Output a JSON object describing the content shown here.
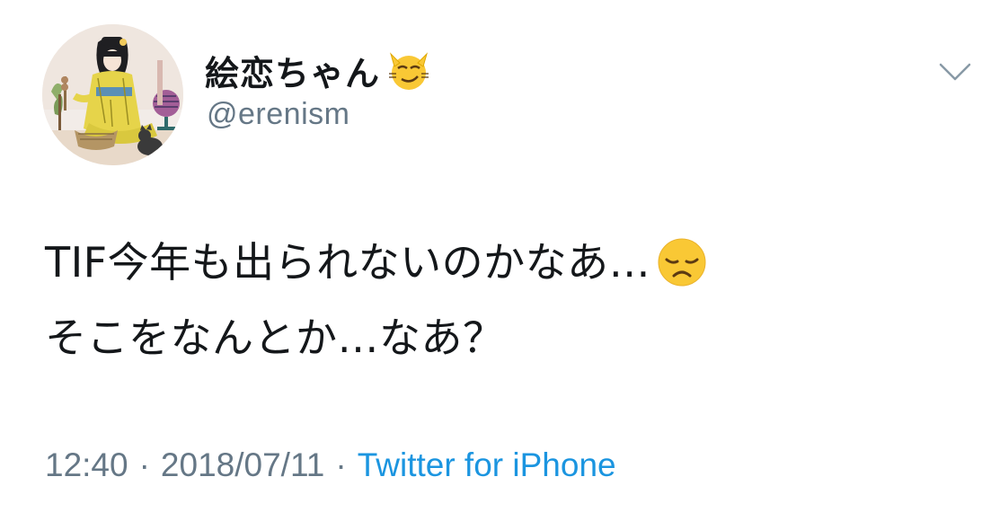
{
  "tweet": {
    "author": {
      "display_name": "絵恋ちゃん",
      "name_emoji": "smirking-cat-emoji",
      "handle": "@erenism",
      "avatar": "illustrated-avatar"
    },
    "menu_icon": "chevron-down-icon",
    "text_lines": [
      "TIF今年も出られないのかなあ…",
      "そこをなんとか…なあ？"
    ],
    "text_emoji": "disappointed-face-emoji",
    "time": "12:40",
    "date": "2018/07/11",
    "separator": "·",
    "source": "Twitter for iPhone"
  },
  "colors": {
    "text": "#14171a",
    "secondary": "#657786",
    "link": "#1b95e0",
    "background": "#ffffff"
  }
}
